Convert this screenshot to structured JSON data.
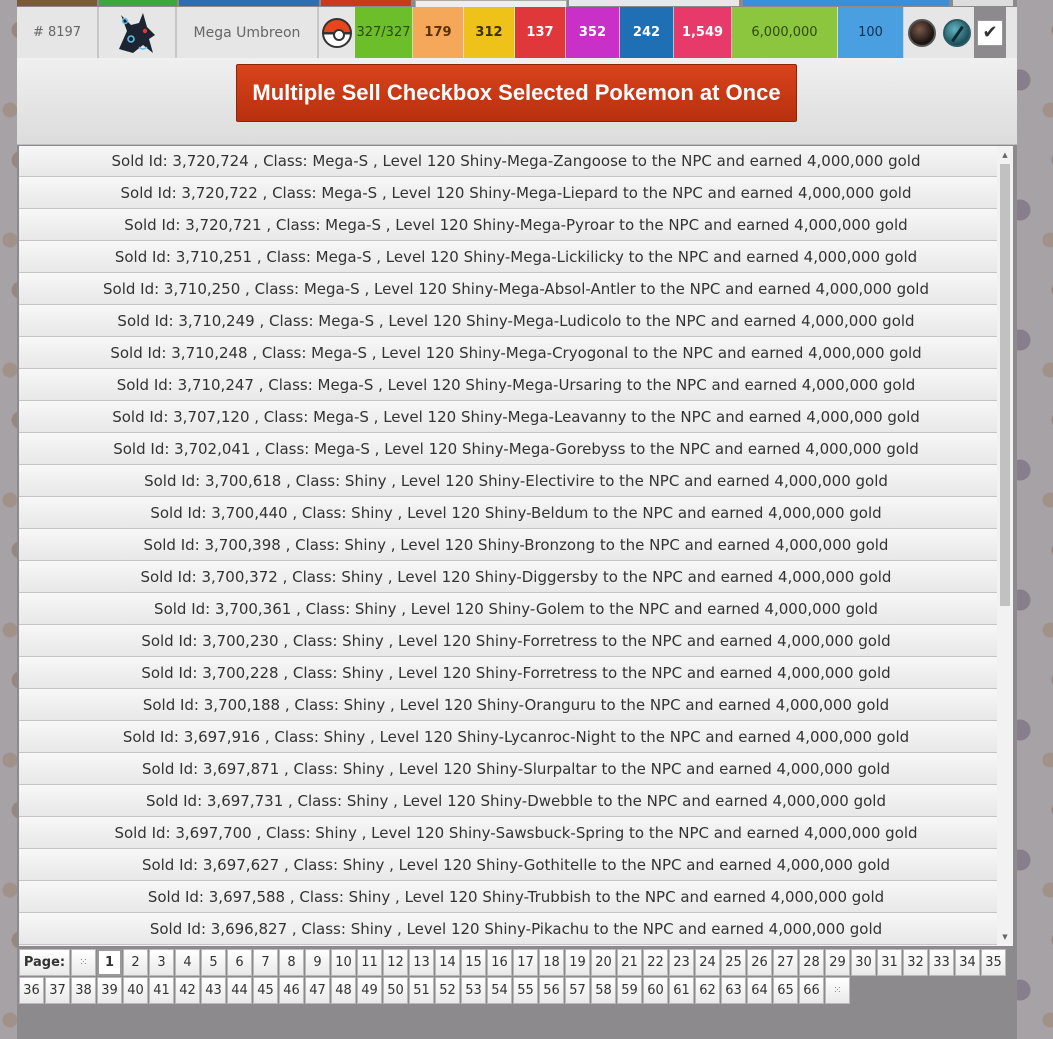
{
  "pokemon_row": {
    "number": "# 8197",
    "name": "Mega Umbreon",
    "hp": "327/327",
    "stats": [
      {
        "value": "179",
        "color": "#f6a85a",
        "text_color": "#5a3200"
      },
      {
        "value": "312",
        "color": "#efc21a",
        "text_color": "#3a3000"
      },
      {
        "value": "137",
        "color": "#e0383a",
        "text_color": "#ffffff"
      },
      {
        "value": "352",
        "color": "#c830c8",
        "text_color": "#ffffff"
      },
      {
        "value": "242",
        "color": "#1e6fb4",
        "text_color": "#ffffff"
      },
      {
        "value": "1,549",
        "color": "#e83a6a",
        "text_color": "#ffffff"
      }
    ],
    "price": "6,000,000",
    "level": "100",
    "checkbox_mark": "✔"
  },
  "sell_button_label": "Multiple Sell Checkbox Selected Pokemon at Once",
  "log": [
    "Sold Id: 3,720,724 , Class: Mega-S , Level 120 Shiny-Mega-Zangoose to the NPC and earned 4,000,000 gold",
    "Sold Id: 3,720,722 , Class: Mega-S , Level 120 Shiny-Mega-Liepard to the NPC and earned 4,000,000 gold",
    "Sold Id: 3,720,721 , Class: Mega-S , Level 120 Shiny-Mega-Pyroar to the NPC and earned 4,000,000 gold",
    "Sold Id: 3,710,251 , Class: Mega-S , Level 120 Shiny-Mega-Lickilicky to the NPC and earned 4,000,000 gold",
    "Sold Id: 3,710,250 , Class: Mega-S , Level 120 Shiny-Mega-Absol-Antler to the NPC and earned 4,000,000 gold",
    "Sold Id: 3,710,249 , Class: Mega-S , Level 120 Shiny-Mega-Ludicolo to the NPC and earned 4,000,000 gold",
    "Sold Id: 3,710,248 , Class: Mega-S , Level 120 Shiny-Mega-Cryogonal to the NPC and earned 4,000,000 gold",
    "Sold Id: 3,710,247 , Class: Mega-S , Level 120 Shiny-Mega-Ursaring to the NPC and earned 4,000,000 gold",
    "Sold Id: 3,707,120 , Class: Mega-S , Level 120 Shiny-Mega-Leavanny to the NPC and earned 4,000,000 gold",
    "Sold Id: 3,702,041 , Class: Mega-S , Level 120 Shiny-Mega-Gorebyss to the NPC and earned 4,000,000 gold",
    "Sold Id: 3,700,618 , Class: Shiny , Level 120 Shiny-Electivire to the NPC and earned 4,000,000 gold",
    "Sold Id: 3,700,440 , Class: Shiny , Level 120 Shiny-Beldum to the NPC and earned 4,000,000 gold",
    "Sold Id: 3,700,398 , Class: Shiny , Level 120 Shiny-Bronzong to the NPC and earned 4,000,000 gold",
    "Sold Id: 3,700,372 , Class: Shiny , Level 120 Shiny-Diggersby to the NPC and earned 4,000,000 gold",
    "Sold Id: 3,700,361 , Class: Shiny , Level 120 Shiny-Golem to the NPC and earned 4,000,000 gold",
    "Sold Id: 3,700,230 , Class: Shiny , Level 120 Shiny-Forretress to the NPC and earned 4,000,000 gold",
    "Sold Id: 3,700,228 , Class: Shiny , Level 120 Shiny-Forretress to the NPC and earned 4,000,000 gold",
    "Sold Id: 3,700,188 , Class: Shiny , Level 120 Shiny-Oranguru to the NPC and earned 4,000,000 gold",
    "Sold Id: 3,697,916 , Class: Shiny , Level 120 Shiny-Lycanroc-Night to the NPC and earned 4,000,000 gold",
    "Sold Id: 3,697,871 , Class: Shiny , Level 120 Shiny-Slurpaltar to the NPC and earned 4,000,000 gold",
    "Sold Id: 3,697,731 , Class: Shiny , Level 120 Shiny-Dwebble to the NPC and earned 4,000,000 gold",
    "Sold Id: 3,697,700 , Class: Shiny , Level 120 Shiny-Sawsbuck-Spring to the NPC and earned 4,000,000 gold",
    "Sold Id: 3,697,627 , Class: Shiny , Level 120 Shiny-Gothitelle to the NPC and earned 4,000,000 gold",
    "Sold Id: 3,697,588 , Class: Shiny , Level 120 Shiny-Trubbish to the NPC and earned 4,000,000 gold",
    "Sold Id: 3,696,827 , Class: Shiny , Level 120 Shiny-Pikachu to the NPC and earned 4,000,000 gold"
  ],
  "pager": {
    "label": "Page:",
    "current": "1",
    "first_ellipsis": "⁙",
    "last_ellipsis": "⁙",
    "pages_line1": [
      "1",
      "2",
      "3",
      "4",
      "5",
      "6",
      "7",
      "8",
      "9",
      "10",
      "11",
      "12",
      "13",
      "14",
      "15",
      "16",
      "17",
      "18",
      "19",
      "20",
      "21",
      "22",
      "23",
      "24",
      "25",
      "26",
      "27",
      "28",
      "29",
      "30",
      "31",
      "32",
      "33",
      "34",
      "35"
    ],
    "pages_line2": [
      "36",
      "37",
      "38",
      "39",
      "40",
      "41",
      "42",
      "43",
      "44",
      "45",
      "46",
      "47",
      "48",
      "49",
      "50",
      "51",
      "52",
      "53",
      "54",
      "55",
      "56",
      "57",
      "58",
      "59",
      "60",
      "61",
      "62",
      "63",
      "64",
      "65",
      "66"
    ]
  },
  "colors": {
    "hp_bar": "#6cbf2a",
    "price_bar": "#8cc63f",
    "level_bar": "#4a9fe0",
    "sell_button": "#c8391a"
  },
  "icons": {
    "pokemon_sprite": "umbreon-sprite-icon",
    "pokeball": "pokeball-icon",
    "held_item": "dark-orb-icon",
    "mega_stone": "mega-stone-icon",
    "checkbox": "checkbox-icon"
  }
}
